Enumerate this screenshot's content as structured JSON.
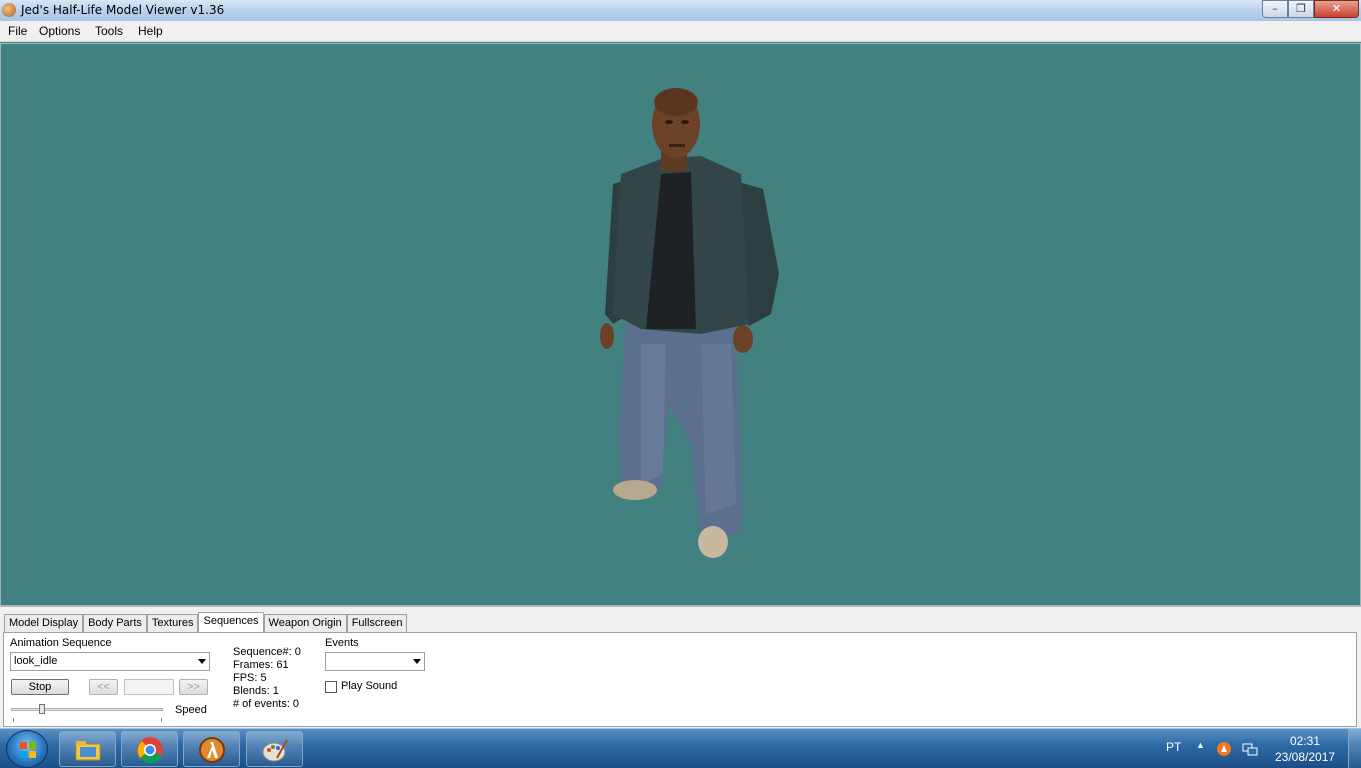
{
  "window": {
    "title": "Jed's Half-Life Model Viewer v1.36",
    "controls": {
      "minimize": "–",
      "restore": "❐",
      "close": "✕"
    }
  },
  "menu": [
    "File",
    "Options",
    "Tools",
    "Help"
  ],
  "viewport": {
    "background": "#438080"
  },
  "tabs": {
    "items": [
      "Model Display",
      "Body Parts",
      "Textures",
      "Sequences",
      "Weapon Origin",
      "Fullscreen"
    ],
    "active": "Sequences"
  },
  "sequences": {
    "animation_label": "Animation Sequence",
    "animation_value": "look_idle",
    "stop_label": "Stop",
    "prev_label": "<<",
    "next_label": ">>",
    "speed_label": "Speed",
    "info": {
      "sequence": "Sequence#: 0",
      "frames": "Frames: 61",
      "fps": "FPS: 5",
      "blends": "Blends: 1",
      "events": "# of events: 0"
    },
    "events_label": "Events",
    "events_value": "",
    "play_sound_label": "Play Sound",
    "play_sound_checked": false
  },
  "taskbar": {
    "apps": [
      "file-explorer-icon",
      "chrome-icon",
      "half-life-icon",
      "paint-icon"
    ],
    "language": "PT",
    "time": "02:31",
    "date": "23/08/2017"
  }
}
